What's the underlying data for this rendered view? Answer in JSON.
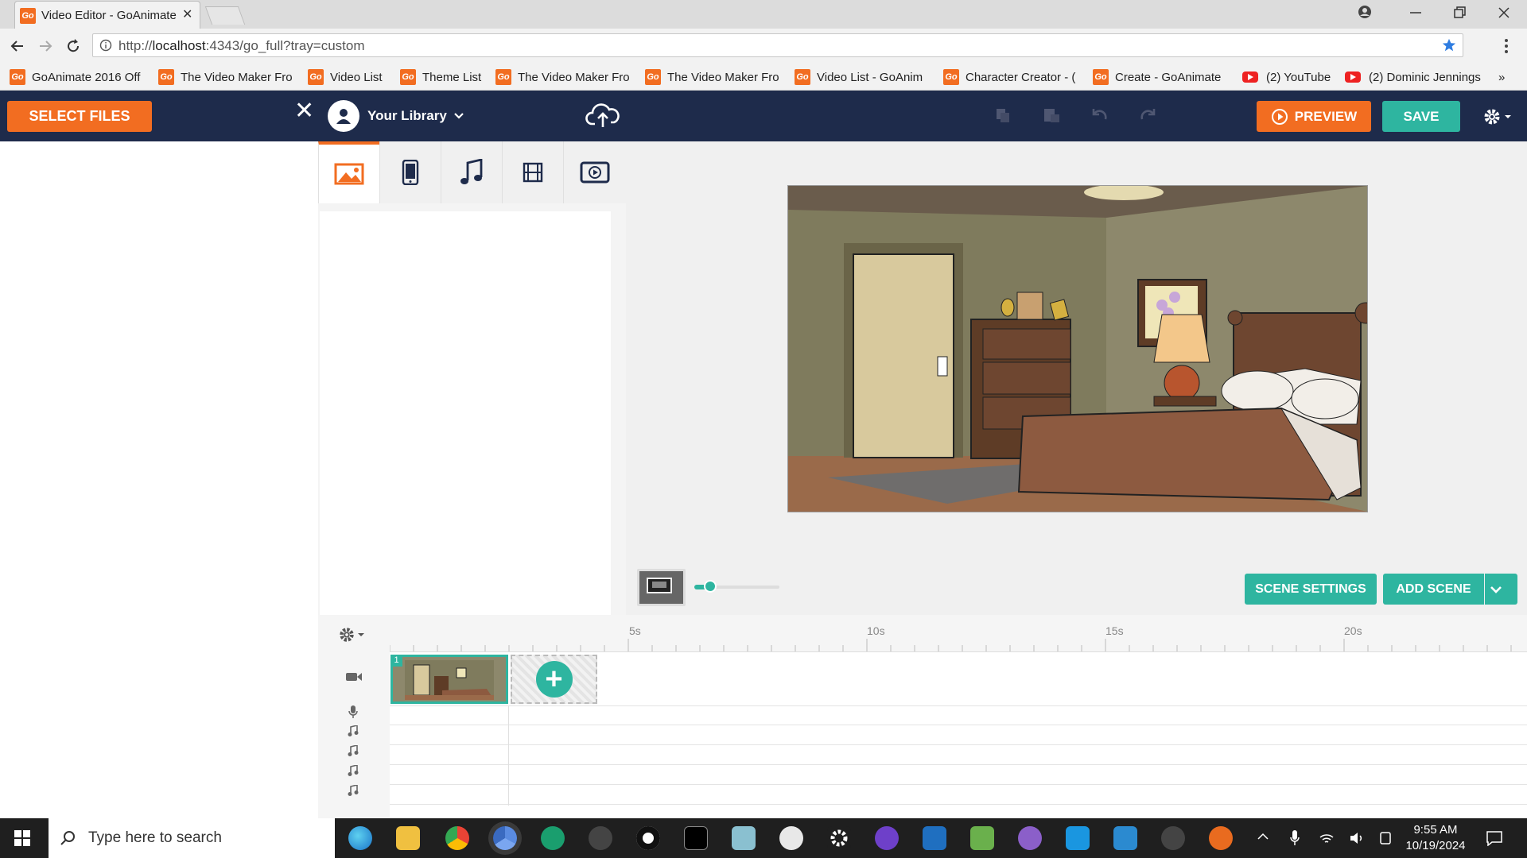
{
  "browser": {
    "tab_title": "Video Editor - GoAnimate",
    "tab_close": "✕",
    "favicon_text": "Go",
    "url_prefix": "http://",
    "url_host": "localhost",
    "url_rest": ":4343/go_full?tray=custom",
    "bookmarks": [
      {
        "label": "GoAnimate 2016 Off",
        "icon": "goanimate-favicon"
      },
      {
        "label": "The Video Maker Fro",
        "icon": "goanimate-favicon"
      },
      {
        "label": "Video List",
        "icon": "goanimate-favicon"
      },
      {
        "label": "Theme List",
        "icon": "goanimate-favicon"
      },
      {
        "label": "The Video Maker Fro",
        "icon": "goanimate-favicon"
      },
      {
        "label": "The Video Maker Fro",
        "icon": "goanimate-favicon"
      },
      {
        "label": "Video List - GoAnim",
        "icon": "goanimate-favicon"
      },
      {
        "label": "Character Creator - (",
        "icon": "goanimate-favicon"
      },
      {
        "label": "Create - GoAnimate",
        "icon": "goanimate-favicon"
      },
      {
        "label": "(2) YouTube",
        "icon": "youtube-favicon"
      },
      {
        "label": "(2) Dominic Jennings",
        "icon": "youtube-favicon"
      }
    ],
    "bookmarks_overflow": "»"
  },
  "toolbar": {
    "select_files": "SELECT FILES",
    "close": "✕",
    "library_label": "Your Library",
    "preview": "PREVIEW",
    "save": "SAVE"
  },
  "library_tabs": [
    "image-icon",
    "phone-icon",
    "music-note-icon",
    "film-icon",
    "video-play-icon"
  ],
  "stage": {
    "scene_settings": "SCENE SETTINGS",
    "add_scene": "ADD SCENE"
  },
  "timeline": {
    "ticks": [
      "5s",
      "10s",
      "15s",
      "20s"
    ],
    "scene_number": "1",
    "add_clip_symbol": "+"
  },
  "taskbar": {
    "search_placeholder": "Type here to search",
    "time": "9:55 AM",
    "date": "10/19/2024"
  },
  "colors": {
    "brand_orange": "#f26d21",
    "teal": "#2eb5a0",
    "navy": "#1e2b4b"
  }
}
